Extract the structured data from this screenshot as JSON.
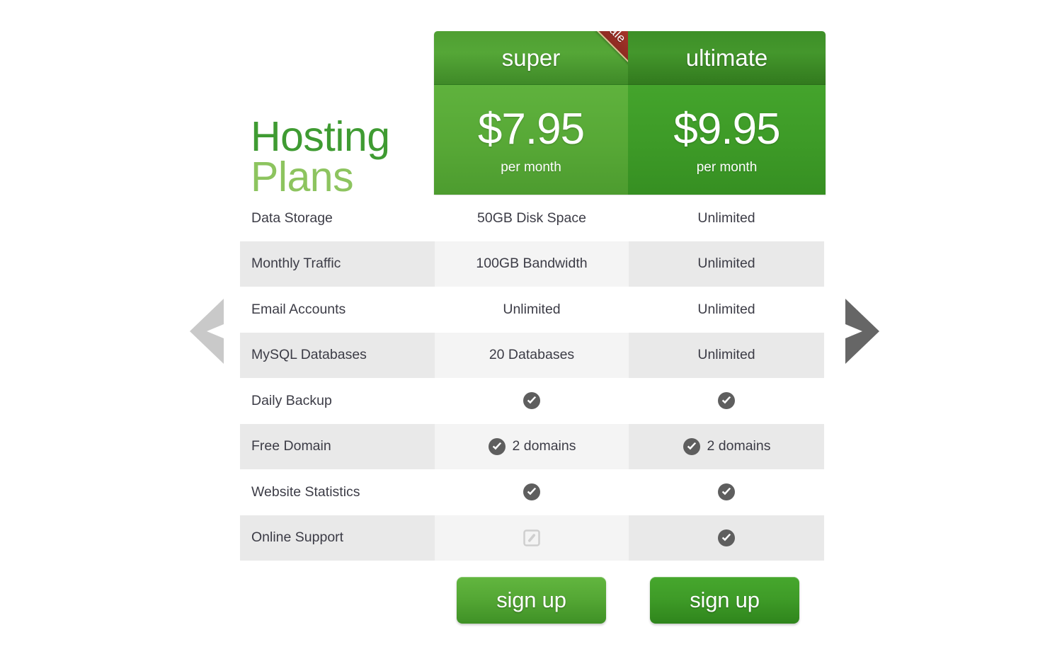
{
  "title": {
    "line1": "Hosting",
    "line2": "Plans",
    "color_dark": "#3f9b32",
    "color_light": "#8dc45f"
  },
  "nav": {
    "prev_label": "previous",
    "next_label": "next",
    "prev_color": "#c9c9c9",
    "next_color": "#666666"
  },
  "badge": {
    "text": "Sale",
    "color": "#9b3028",
    "edge_color": "#e0cb9e"
  },
  "plans": [
    {
      "key": "super",
      "name": "super",
      "price": "$7.95",
      "period": "per month",
      "accent": "#55a836",
      "signup_label": "sign up",
      "has_sale_badge": true
    },
    {
      "key": "ultimate",
      "name": "ultimate",
      "price": "$9.95",
      "period": "per month",
      "accent": "#3f9c28",
      "signup_label": "sign up",
      "has_sale_badge": false
    }
  ],
  "features": [
    {
      "label": "Data Storage",
      "super": {
        "type": "text",
        "text": "50GB Disk Space"
      },
      "ultimate": {
        "type": "text",
        "text": "Unlimited"
      }
    },
    {
      "label": "Monthly Traffic",
      "super": {
        "type": "text",
        "text": "100GB Bandwidth"
      },
      "ultimate": {
        "type": "text",
        "text": "Unlimited"
      }
    },
    {
      "label": "Email Accounts",
      "super": {
        "type": "text",
        "text": "Unlimited"
      },
      "ultimate": {
        "type": "text",
        "text": "Unlimited"
      }
    },
    {
      "label": "MySQL Databases",
      "super": {
        "type": "text",
        "text": "20 Databases"
      },
      "ultimate": {
        "type": "text",
        "text": "Unlimited"
      }
    },
    {
      "label": "Daily Backup",
      "super": {
        "type": "check",
        "text": ""
      },
      "ultimate": {
        "type": "check",
        "text": ""
      }
    },
    {
      "label": "Free Domain",
      "super": {
        "type": "check",
        "text": "2 domains"
      },
      "ultimate": {
        "type": "check",
        "text": "2 domains"
      }
    },
    {
      "label": "Website Statistics",
      "super": {
        "type": "check",
        "text": ""
      },
      "ultimate": {
        "type": "check",
        "text": ""
      }
    },
    {
      "label": "Online Support",
      "super": {
        "type": "disabled",
        "text": ""
      },
      "ultimate": {
        "type": "check",
        "text": ""
      }
    }
  ],
  "icons": {
    "check": "check-circle-icon",
    "disabled": "unavailable-icon",
    "prev": "chevron-left-icon",
    "next": "chevron-right-icon"
  }
}
